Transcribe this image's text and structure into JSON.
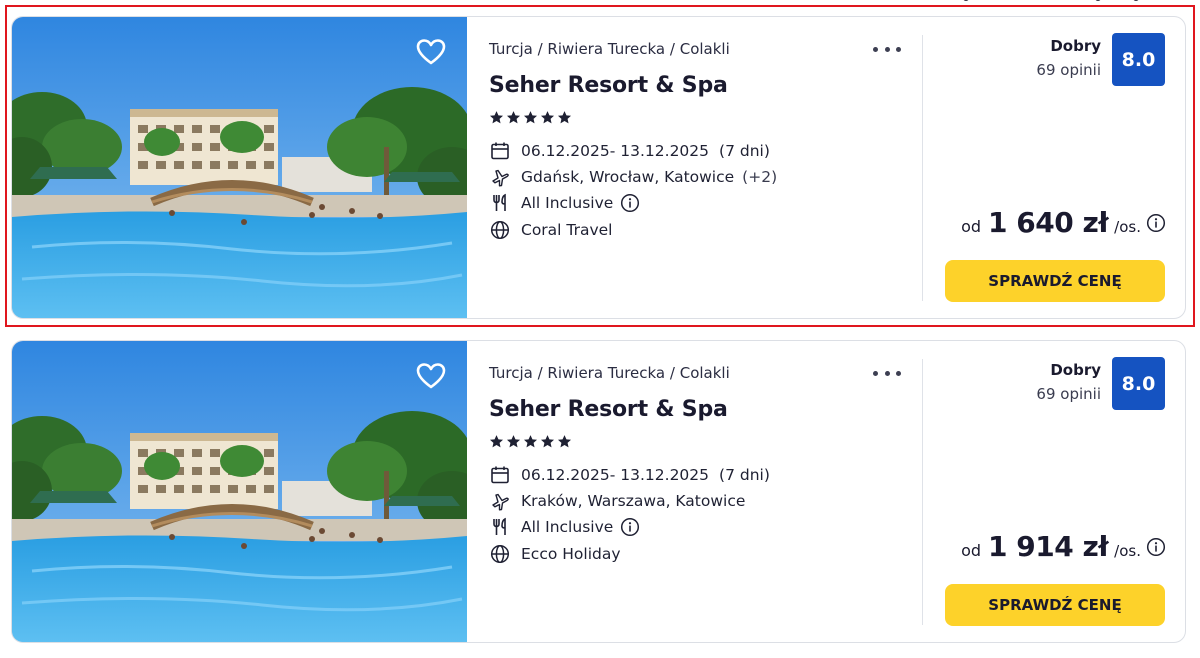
{
  "offers": [
    {
      "breadcrumb": "Turcja / Riwiera Turecka / Colakli",
      "hotel_name": "Seher Resort & Spa",
      "stars": 5,
      "dates": "06.12.2025- 13.12.2025",
      "duration": "(7 dni)",
      "departure": "Gdańsk, Wrocław, Katowice",
      "departure_extra": "(+2)",
      "board": "All Inclusive",
      "operator": "Coral Travel",
      "rating_label": "Dobry",
      "reviews": "69 opinii",
      "score": "8.0",
      "price_prefix": "od",
      "price": "1 640 zł",
      "price_suffix": "/os.",
      "cta_label": "SPRAWDŹ CENĘ",
      "highlighted": true
    },
    {
      "breadcrumb": "Turcja / Riwiera Turecka / Colakli",
      "hotel_name": "Seher Resort & Spa",
      "stars": 5,
      "dates": "06.12.2025- 13.12.2025",
      "duration": "(7 dni)",
      "departure": "Kraków, Warszawa, Katowice",
      "departure_extra": "",
      "board": "All Inclusive",
      "operator": "Ecco Holiday",
      "rating_label": "Dobry",
      "reviews": "69 opinii",
      "score": "8.0",
      "price_prefix": "od",
      "price": "1 914 zł",
      "price_suffix": "/os.",
      "cta_label": "SPRAWDŹ CENĘ",
      "highlighted": false
    }
  ],
  "colors": {
    "score_badge": "#1553c1",
    "cta_button": "#fdd22a",
    "highlight_border": "#e0161e"
  },
  "icons": {
    "favorite": "heart-outline-icon",
    "more": "more-dots-icon",
    "dates": "calendar-icon",
    "departure": "plane-icon",
    "board": "cutlery-icon",
    "operator": "globe-icon",
    "info": "info-circle-icon",
    "star": "star-icon"
  }
}
